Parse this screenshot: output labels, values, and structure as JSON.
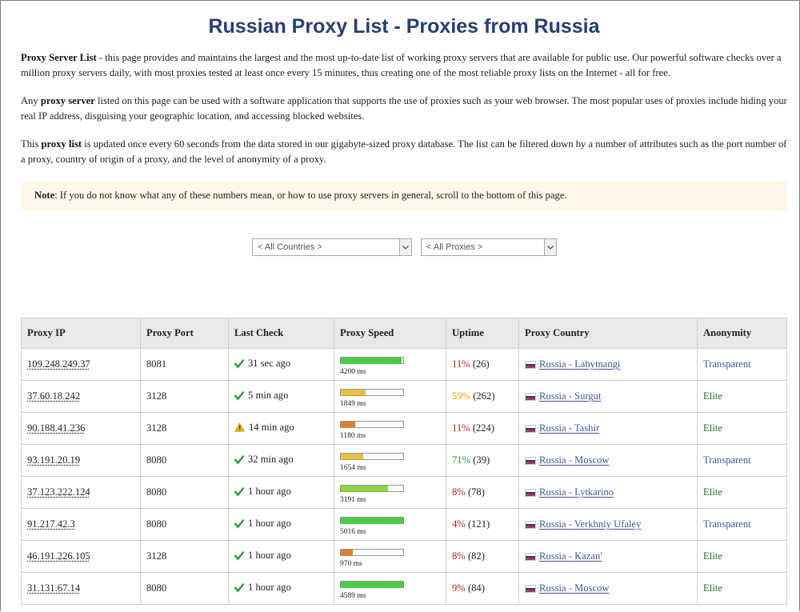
{
  "page": {
    "title": "Russian Proxy List - Proxies from Russia",
    "p1": {
      "bold": "Proxy Server List",
      "text": " - this page provides and maintains the largest and the most up-to-date list of working proxy servers that are available for public use. Our powerful software checks over a million proxy servers daily, with most proxies tested at least once every 15 minutes, thus creating one of the most reliable proxy lists on the Internet - all for free."
    },
    "p2": {
      "pre": "Any ",
      "bold": "proxy server",
      "text": " listed on this page can be used with a software application that supports the use of proxies such as your web browser. The most popular uses of proxies include hiding your real IP address, disguising your geographic location, and accessing blocked websites."
    },
    "p3": {
      "pre": "This ",
      "bold": "proxy list",
      "text": " is updated once every 60 seconds from the data stored in our gigabyte-sized proxy database. The list can be filtered down by a number of attributes such as the port number of a proxy, country of origin of a proxy, and the level of anonymity of a proxy."
    },
    "note": {
      "bold": "Note",
      "text": ": If you do not know what any of these numbers mean, or how to use proxy servers in general, scroll to the bottom of this page."
    }
  },
  "filters": {
    "country": "< All Countries >",
    "proxies": "< All Proxies >"
  },
  "colors": {
    "title": "#253f73",
    "speed_green": "#3fd23f",
    "speed_light_green": "#8fd63a",
    "speed_yellow": "#e8c13a",
    "speed_orange": "#e07b2a",
    "check_green": "#2e9c2e",
    "warn_yellow": "#f0b400"
  },
  "table": {
    "headers": [
      "Proxy IP",
      "Proxy Port",
      "Last Check",
      "Proxy Speed",
      "Uptime",
      "Proxy Country",
      "Anonymity"
    ],
    "rows": [
      {
        "ip": "109.248.249.37",
        "port": "8081",
        "status": "check",
        "last": "31 sec ago",
        "speed_pct": 98,
        "speed_color": "#3fd23f",
        "ms": "4200 ms",
        "up_pct": "11%",
        "up_count": " (26)",
        "up_class": "up-r",
        "country": "Russia - Labytnangi",
        "anon": "Transparent"
      },
      {
        "ip": "37.60.18.242",
        "port": "3128",
        "status": "check",
        "last": "5 min ago",
        "speed_pct": 40,
        "speed_color": "#e8c13a",
        "ms": "1849 ms",
        "up_pct": "59%",
        "up_count": " (262)",
        "up_class": "up-o",
        "country": "Russia - Surgut",
        "anon": "Elite"
      },
      {
        "ip": "90.188.41.236",
        "port": "3128",
        "status": "warn",
        "last": "14 min ago",
        "speed_pct": 23,
        "speed_color": "#e07b2a",
        "ms": "1180 ms",
        "up_pct": "11%",
        "up_count": " (224)",
        "up_class": "up-r",
        "country": "Russia - Tashir",
        "anon": "Elite"
      },
      {
        "ip": "93.191.20.19",
        "port": "8080",
        "status": "check",
        "last": "32 min ago",
        "speed_pct": 36,
        "speed_color": "#e8c13a",
        "ms": "1654 ms",
        "up_pct": "71%",
        "up_count": " (39)",
        "up_class": "up-g",
        "country": "Russia - Moscow",
        "anon": "Transparent"
      },
      {
        "ip": "37.123.222.124",
        "port": "8080",
        "status": "check",
        "last": "1 hour ago",
        "speed_pct": 75,
        "speed_color": "#8fd63a",
        "ms": "3191 ms",
        "up_pct": "8%",
        "up_count": " (78)",
        "up_class": "up-r",
        "country": "Russia - Lytkarino",
        "anon": "Elite"
      },
      {
        "ip": "91.217.42.3",
        "port": "8080",
        "status": "check",
        "last": "1 hour ago",
        "speed_pct": 100,
        "speed_color": "#3fd23f",
        "ms": "5016 ms",
        "up_pct": "4%",
        "up_count": " (121)",
        "up_class": "up-r",
        "country": "Russia - Verkhniy Ufaley",
        "anon": "Transparent"
      },
      {
        "ip": "46.191.226.105",
        "port": "3128",
        "status": "check",
        "last": "1 hour ago",
        "speed_pct": 19,
        "speed_color": "#e07b2a",
        "ms": "970 ms",
        "up_pct": "8%",
        "up_count": " (82)",
        "up_class": "up-r",
        "country": "Russia - Kazan'",
        "anon": "Elite"
      },
      {
        "ip": "31.131.67.14",
        "port": "8080",
        "status": "check",
        "last": "1 hour ago",
        "speed_pct": 100,
        "speed_color": "#3fd23f",
        "ms": "4589 ms",
        "up_pct": "9%",
        "up_count": " (84)",
        "up_class": "up-r",
        "country": "Russia - Moscow",
        "anon": "Elite"
      }
    ]
  }
}
